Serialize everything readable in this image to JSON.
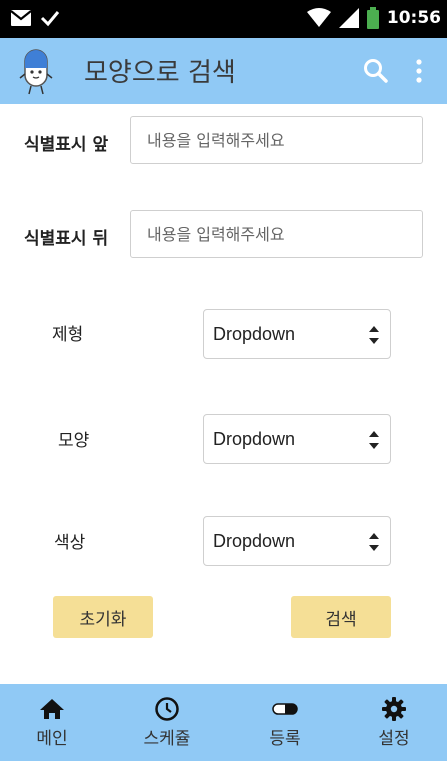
{
  "status_bar": {
    "time": "10:56",
    "icons": [
      "mail-icon",
      "check-icon",
      "wifi-icon",
      "signal-icon",
      "battery-icon"
    ],
    "battery_color": "#4caf50"
  },
  "app_bar": {
    "title": "모양으로 검색",
    "background": "#90c9f5",
    "icons": [
      "pill-mascot-logo",
      "search-icon",
      "more-vert-icon"
    ]
  },
  "form": {
    "front_mark": {
      "label": "식별표시 앞",
      "placeholder": "내용을 입력해주세요"
    },
    "back_mark": {
      "label": "식별표시 뒤",
      "placeholder": "내용을 입력해주세요"
    },
    "form_type": {
      "label": "제형",
      "value": "Dropdown"
    },
    "shape": {
      "label": "모양",
      "value": "Dropdown"
    },
    "color": {
      "label": "색상",
      "value": "Dropdown"
    },
    "reset_label": "초기화",
    "search_label": "검색",
    "button_color": "#f5df96"
  },
  "bottom_nav": {
    "items": [
      {
        "label": "메인",
        "icon": "home-icon"
      },
      {
        "label": "스케쥴",
        "icon": "clock-icon"
      },
      {
        "label": "등록",
        "icon": "pill-icon"
      },
      {
        "label": "설정",
        "icon": "gear-icon"
      }
    ]
  }
}
